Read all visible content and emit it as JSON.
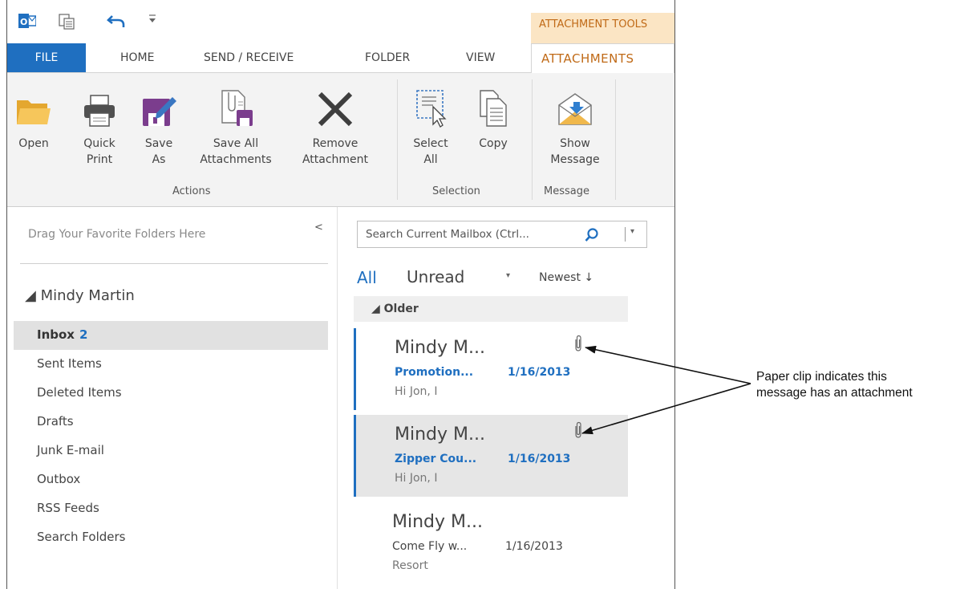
{
  "quick_access": {
    "app_icon": "outlook-logo-icon",
    "icons": [
      "send-receive-all-icon",
      "undo-icon",
      "customize-qat-icon"
    ]
  },
  "contextual_tab_title": "ATTACHMENT TOOLS",
  "tabs": [
    {
      "label": "FILE"
    },
    {
      "label": "HOME"
    },
    {
      "label": "SEND / RECEIVE"
    },
    {
      "label": "FOLDER"
    },
    {
      "label": "VIEW"
    },
    {
      "label": "ATTACHMENTS"
    }
  ],
  "ribbon": {
    "buttons": {
      "open": {
        "line1": "Open",
        "line2": "",
        "icon": "folder-icon"
      },
      "quick_print": {
        "line1": "Quick",
        "line2": "Print",
        "icon": "printer-icon"
      },
      "save_as": {
        "line1": "Save",
        "line2": "As",
        "icon": "floppy-pen-icon"
      },
      "save_all": {
        "line1": "Save All",
        "line2": "Attachments",
        "icon": "save-all-attachments-icon"
      },
      "remove": {
        "line1": "Remove",
        "line2": "Attachment",
        "icon": "x-icon"
      },
      "select_all": {
        "line1": "Select",
        "line2": "All",
        "icon": "select-all-icon"
      },
      "copy": {
        "line1": "Copy",
        "line2": "",
        "icon": "copy-icon"
      },
      "show_message": {
        "line1": "Show",
        "line2": "Message",
        "icon": "envelope-arrow-icon"
      }
    },
    "groups": [
      "Actions",
      "Selection",
      "Message"
    ]
  },
  "folder_pane": {
    "favorites_placeholder": "Drag Your Favorite Folders Here",
    "collapse_glyph": "<",
    "account": "◢ Mindy Martin",
    "folders": [
      {
        "name": "Inbox",
        "count": "2",
        "selected": true
      },
      {
        "name": "Sent Items",
        "count": ""
      },
      {
        "name": "Deleted Items",
        "count": ""
      },
      {
        "name": "Drafts",
        "count": ""
      },
      {
        "name": "Junk E-mail",
        "count": ""
      },
      {
        "name": "Outbox",
        "count": ""
      },
      {
        "name": "RSS Feeds",
        "count": ""
      },
      {
        "name": "Search Folders",
        "count": ""
      }
    ]
  },
  "message_list": {
    "search_placeholder": "Search Current Mailbox (Ctrl...",
    "filters": {
      "all": "All",
      "unread": "Unread",
      "dropdown": "▾"
    },
    "sort": "Newest ↓",
    "group_header": "◢ Older",
    "messages": [
      {
        "sender": "Mindy M...",
        "subject": "Promotion...",
        "date": "1/16/2013",
        "preview": "Hi Jon, I",
        "has_attachment": true,
        "unread": true,
        "selected": false
      },
      {
        "sender": "Mindy M...",
        "subject": "Zipper Cou...",
        "date": "1/16/2013",
        "preview": "Hi Jon, I",
        "has_attachment": true,
        "unread": true,
        "selected": true
      },
      {
        "sender": "Mindy M...",
        "subject": "Come Fly w...",
        "date": "1/16/2013",
        "preview": "Resort",
        "has_attachment": false,
        "unread": false,
        "selected": false
      }
    ]
  },
  "annotation": {
    "line1": "Paper clip indicates this",
    "line2": "message has an attachment"
  },
  "colors": {
    "accent_blue": "#1f6fc0",
    "context_orange": "#c06a17",
    "context_bg": "#fbe5c4"
  }
}
